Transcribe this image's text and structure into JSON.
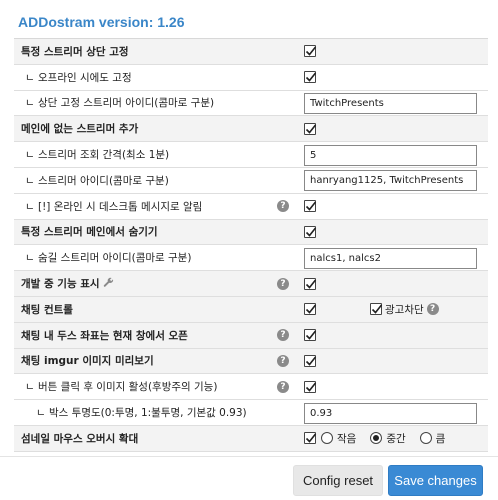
{
  "header": {
    "title": "ADDostram version: 1.26"
  },
  "settings": {
    "fix_top": {
      "label": "특정 스트리머 상단 고정",
      "checked": true
    },
    "fix_offline": {
      "label": "ㄴ 오프라인 시에도 고정",
      "checked": true
    },
    "fix_ids": {
      "label": "ㄴ 상단 고정 스트리머 아이디(콤마로 구분)",
      "value": "TwitchPresents"
    },
    "add_streamer": {
      "label": "메인에 없는 스트리머 추가",
      "checked": true
    },
    "interval": {
      "label": "ㄴ 스트리머 조회 간격(최소 1분)",
      "value": "5"
    },
    "streamer_ids": {
      "label": "ㄴ 스트리머 아이디(콤마로 구분)",
      "value": "hanryang1125, TwitchPresents"
    },
    "desktop_alert": {
      "label": "ㄴ [!] 온라인 시 데스크톱 메시지로 알림",
      "checked": true,
      "help": "?"
    },
    "hide_main": {
      "label": "특정 스트리머 메인에서 숨기기",
      "checked": true
    },
    "hide_ids": {
      "label": "ㄴ 숨길 스트리머 아이디(콤마로 구분)",
      "value": "nalcs1, nalcs2"
    },
    "dev_features": {
      "label": "개발 중 기능 표시",
      "checked": true,
      "help": "?",
      "icon": "wrench-icon"
    },
    "chat_control": {
      "label": "채팅 컨트롤",
      "checked": true,
      "adblock_label": "광고차단",
      "adblock_checked": true,
      "help": "?"
    },
    "chat_coords": {
      "label": "채팅 내 두스 좌표는 현재 창에서 오픈",
      "checked": true,
      "help": "?"
    },
    "chat_imgur": {
      "label": "채팅 imgur 이미지 미리보기",
      "checked": true,
      "help": "?"
    },
    "click_activate": {
      "label": "ㄴ 버튼 클릭 후 이미지 활성(후방주의 기능)",
      "checked": true,
      "help": "?"
    },
    "box_opacity": {
      "label": "ㄴ 박스 투명도(0:투명, 1:불투명, 기본값 0.93)",
      "value": "0.93"
    },
    "thumb_zoom": {
      "label": "섬네일 마우스 오버시 확대",
      "checked": true,
      "options": [
        {
          "label": "작음",
          "selected": false
        },
        {
          "label": "중간",
          "selected": true
        },
        {
          "label": "큼",
          "selected": false
        }
      ]
    }
  },
  "footer": {
    "reset_label": "Config reset",
    "save_label": "Save changes"
  },
  "colors": {
    "accent": "#3a86c8",
    "save_button": "#3a8ad4",
    "main_row_bg": "#f3f3f3"
  }
}
